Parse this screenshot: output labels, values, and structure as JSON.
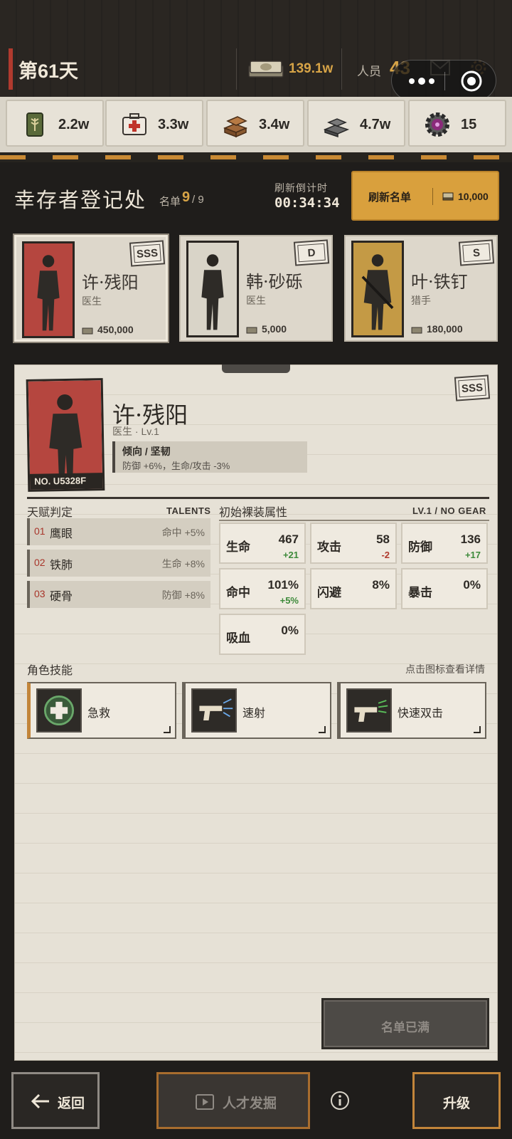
{
  "topbar": {
    "day": "第61天",
    "money": "139.1w",
    "staff_label": "人员",
    "staff_value": "43"
  },
  "resources": [
    {
      "icon": "wheat-can-icon",
      "value": "2.2w"
    },
    {
      "icon": "medkit-icon",
      "value": "3.3w"
    },
    {
      "icon": "wood-planks-icon",
      "value": "3.4w"
    },
    {
      "icon": "steel-ingots-icon",
      "value": "4.7w"
    },
    {
      "icon": "gear-gem-icon",
      "value": "15"
    }
  ],
  "header": {
    "title": "幸存者登记处",
    "roster_label": "名单",
    "roster_count": "9",
    "roster_total": "/ 9",
    "countdown_label": "刷新倒计时",
    "countdown_value": "00:34:34",
    "refresh_label": "刷新名单",
    "refresh_cost": "10,000"
  },
  "candidates": [
    {
      "name": "许·残阳",
      "role": "医生",
      "price": "450,000",
      "grade": "SSS",
      "portrait_color": "#b5463f"
    },
    {
      "name": "韩·砂砾",
      "role": "医生",
      "price": "5,000",
      "grade": "D",
      "portrait_color": "#d9d4c8"
    },
    {
      "name": "叶·铁钉",
      "role": "猎手",
      "price": "180,000",
      "grade": "S",
      "portrait_color": "#c49a45"
    }
  ],
  "detail": {
    "name": "许·残阳",
    "subtitle": "医生 · Lv.1",
    "serial": "NO. U5328F",
    "grade": "SSS",
    "trait_title": "倾向 /  坚韧",
    "trait_desc": "防御 +6%，生命/攻击 -3%",
    "talents_label": "天赋判定",
    "talents_en": "TALENTS",
    "talents": [
      {
        "no": "01",
        "name": "鹰眼",
        "bonus": "命中 +5%"
      },
      {
        "no": "02",
        "name": "铁肺",
        "bonus": "生命 +8%"
      },
      {
        "no": "03",
        "name": "硬骨",
        "bonus": "防御 +8%"
      }
    ],
    "stats_label": "初始裸装属性",
    "stats_en": "LV.1 / NO GEAR",
    "stats": [
      {
        "key": "生命",
        "value": "467",
        "delta": "+21",
        "sign": "pos"
      },
      {
        "key": "攻击",
        "value": "58",
        "delta": "-2",
        "sign": "neg"
      },
      {
        "key": "防御",
        "value": "136",
        "delta": "+17",
        "sign": "pos"
      },
      {
        "key": "命中",
        "value": "101%",
        "delta": "+5%",
        "sign": "pos"
      },
      {
        "key": "闪避",
        "value": "8%",
        "delta": "",
        "sign": ""
      },
      {
        "key": "暴击",
        "value": "0%",
        "delta": "",
        "sign": ""
      },
      {
        "key": "吸血",
        "value": "0%",
        "delta": "",
        "sign": ""
      }
    ],
    "skills_label": "角色技能",
    "skills_hint": "点击图标查看详情",
    "skills": [
      {
        "name": "急救",
        "icon": "first-aid-cross-icon"
      },
      {
        "name": "速射",
        "icon": "pistol-rapid-fire-icon"
      },
      {
        "name": "快速双击",
        "icon": "pistol-double-tap-icon"
      }
    ],
    "full_label": "名单已满"
  },
  "bottom": {
    "back_label": "返回",
    "talent_label": "人才发掘",
    "upgrade_label": "升级"
  },
  "colors": {
    "accent": "#d9a03d",
    "gold_text": "#d7a447",
    "danger": "#b0392c",
    "positive": "#3d8a3a"
  }
}
